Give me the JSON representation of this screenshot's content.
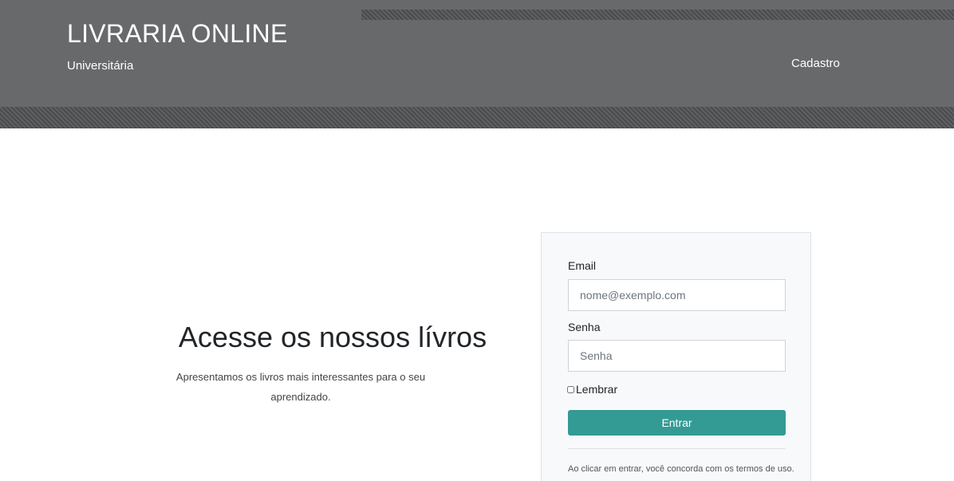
{
  "header": {
    "title": "LIVRARIA ONLINE",
    "subtitle": "Universitária",
    "nav": {
      "signup_label": "Cadastro"
    },
    "colors": {
      "background": "#68696b",
      "text": "#ffffff"
    }
  },
  "hero": {
    "title": "Acesse os nossos lívros",
    "text": "Apresentamos os livros mais interessantes para o seu aprendizado."
  },
  "login": {
    "email_label": "Email",
    "email_placeholder": "nome@exemplo.com",
    "email_value": "",
    "password_label": "Senha",
    "password_placeholder": "Senha",
    "password_value": "",
    "remember_label": "Lembrar",
    "remember_checked": false,
    "submit_label": "Entrar",
    "terms_text": "Ao clicar em entrar, você concorda com os termos de uso.",
    "colors": {
      "button": "#339a94",
      "card": "#f8f9fa"
    }
  }
}
